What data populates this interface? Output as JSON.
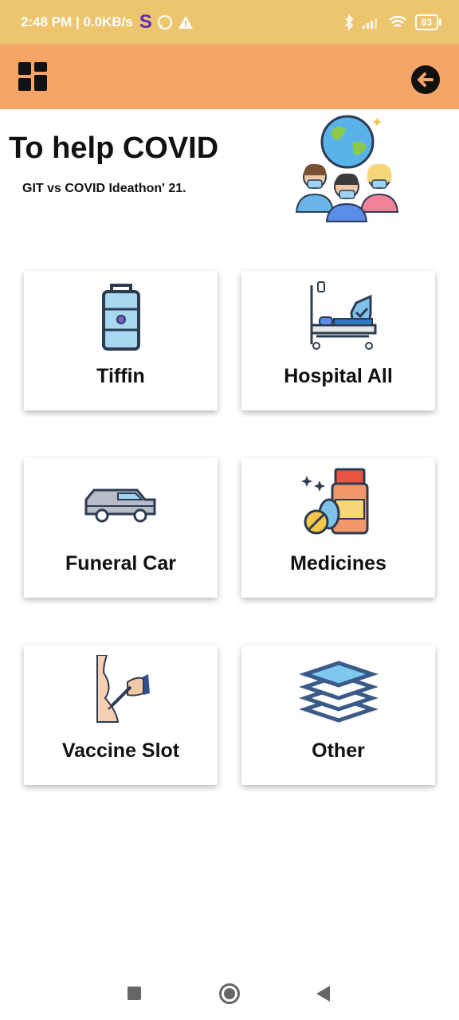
{
  "status_bar": {
    "time": "2:48 PM | 0.0KB/s",
    "s_icon": "S",
    "battery": "83"
  },
  "app_bar": {
    "menu_icon": "dashboard-icon",
    "logout_icon": "logout-icon"
  },
  "header": {
    "title": "To help COVID",
    "subtitle": "GIT vs COVID Ideathon' 21."
  },
  "cards": [
    {
      "label": "Tiffin",
      "icon": "tiffin-icon"
    },
    {
      "label": "Hospital All",
      "icon": "hospital-bed-icon"
    },
    {
      "label": "Funeral Car",
      "icon": "hearse-icon"
    },
    {
      "label": "Medicines",
      "icon": "medicine-bottle-icon"
    },
    {
      "label": "Vaccine Slot",
      "icon": "vaccine-syringe-icon"
    },
    {
      "label": "Other",
      "icon": "layers-icon"
    }
  ],
  "colors": {
    "status_bar": "#ecc56e",
    "app_bar": "#f4a567"
  }
}
